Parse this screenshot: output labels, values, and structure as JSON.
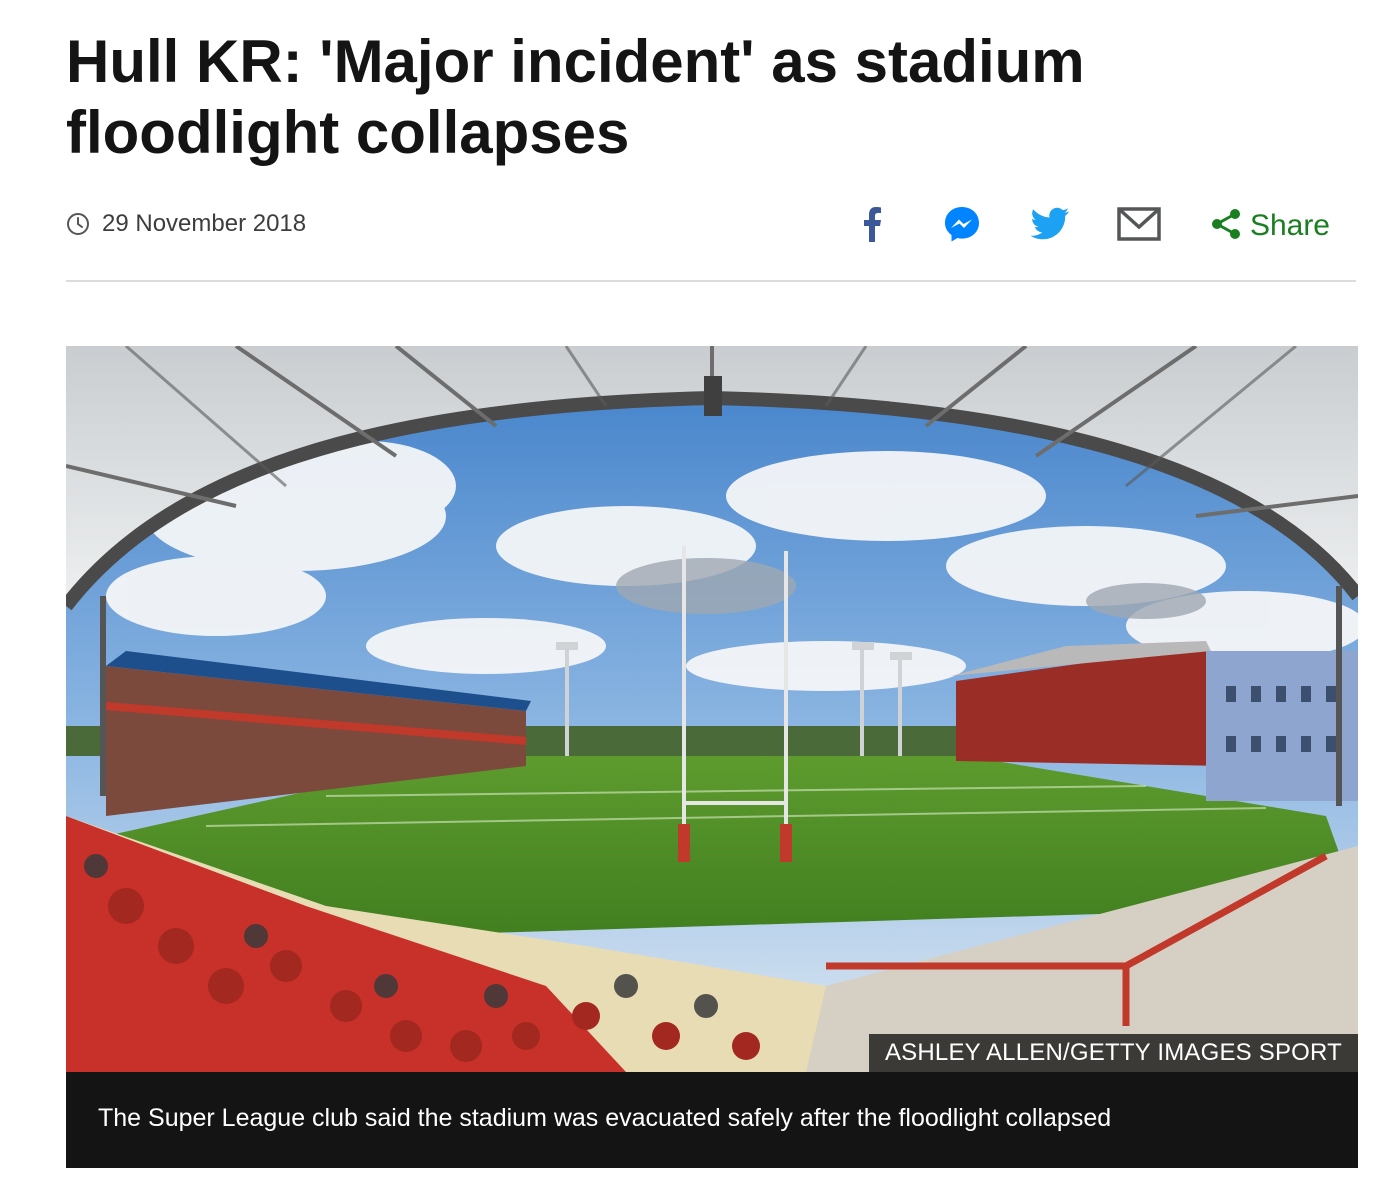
{
  "article": {
    "headline": "Hull KR: 'Major incident' as stadium floodlight collapses",
    "date": "29 November 2018"
  },
  "share_bar": {
    "share_label": "Share",
    "icons": [
      "facebook-icon",
      "messenger-icon",
      "twitter-icon",
      "email-icon",
      "share-icon"
    ],
    "colors": {
      "facebook": "#3b5998",
      "messenger": "#0084ff",
      "twitter": "#1da1f2",
      "email": "#545658",
      "share": "#1a7f21"
    }
  },
  "image": {
    "credit": "ASHLEY ALLEN/GETTY IMAGES SPORT",
    "caption": "The Super League club said the stadium was evacuated safely after the floodlight collapsed"
  }
}
